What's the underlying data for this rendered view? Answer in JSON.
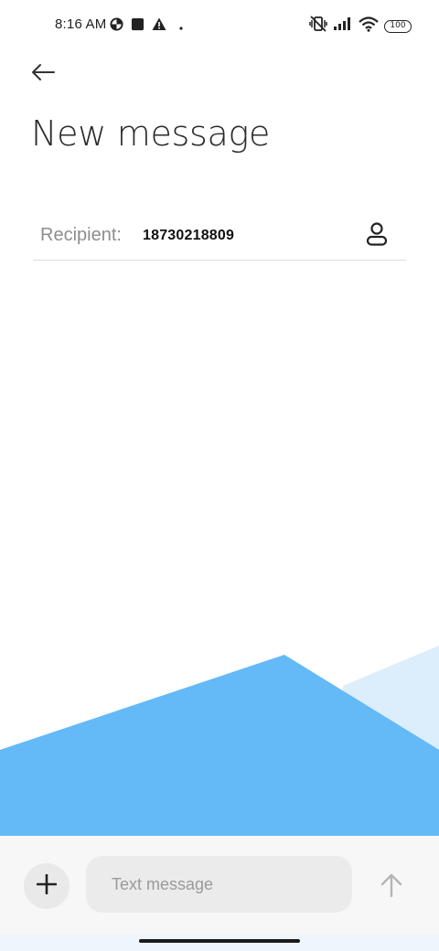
{
  "status_bar": {
    "time": "8:16 AM",
    "battery": "100",
    "icons": [
      "data-saver-icon",
      "square-notification-icon",
      "warning-icon",
      "dot-icon",
      "vibrate-off-icon",
      "signal-icon",
      "wifi-icon",
      "battery-icon"
    ]
  },
  "header": {
    "back_icon": "arrow-left-icon",
    "title": "New message"
  },
  "recipient": {
    "label": "Recipient:",
    "value": "18730218809",
    "contact_icon": "person-icon"
  },
  "composer": {
    "add_icon": "plus-icon",
    "input_value": "",
    "input_placeholder": "Text message",
    "send_icon": "arrow-up-icon"
  },
  "colors": {
    "decor_primary": "#64b9f7",
    "decor_light": "#dcedfb",
    "composer_bg": "#f7f7f7",
    "input_bg": "#ebebeb"
  }
}
